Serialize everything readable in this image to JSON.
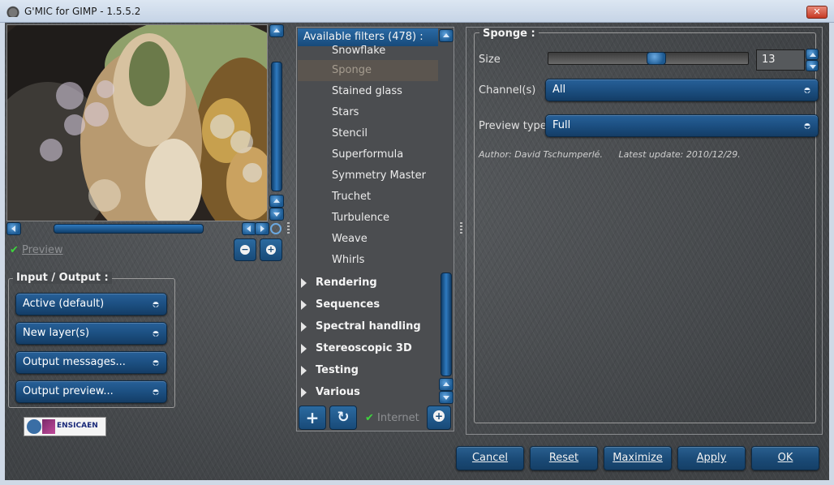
{
  "window": {
    "title": "G'MIC for GIMP - 1.5.5.2",
    "close_label": "✕"
  },
  "preview": {
    "checkbox_label": "Preview",
    "checked": true,
    "zoom_out_label": "−",
    "zoom_in_label": "+"
  },
  "io": {
    "group_title": "Input / Output :",
    "input_select": "Active (default)",
    "output_select": "New layer(s)",
    "messages_select": "Output messages...",
    "preview_select": "Output preview..."
  },
  "logo": {
    "text": "ENSICAEN"
  },
  "filters": {
    "header": "Available filters (478) :",
    "items": [
      {
        "label": "Snowflake"
      },
      {
        "label": "Sponge",
        "selected": true
      },
      {
        "label": "Stained glass"
      },
      {
        "label": "Stars"
      },
      {
        "label": "Stencil"
      },
      {
        "label": "Superformula"
      },
      {
        "label": "Symmetry Master"
      },
      {
        "label": "Truchet"
      },
      {
        "label": "Turbulence"
      },
      {
        "label": "Weave"
      },
      {
        "label": "Whirls"
      }
    ],
    "categories": [
      {
        "label": "Rendering"
      },
      {
        "label": "Sequences"
      },
      {
        "label": "Spectral handling"
      },
      {
        "label": "Stereoscopic 3D"
      },
      {
        "label": "Testing"
      },
      {
        "label": "Various"
      }
    ],
    "add_label": "+",
    "refresh_label": "↻",
    "internet_label": "Internet",
    "internet_checked": true
  },
  "params": {
    "title": "Sponge :",
    "size_label": "Size",
    "size_value": "13",
    "size_level": 0.55,
    "channels_label": "Channel(s)",
    "channels_value": "All",
    "preview_type_label": "Preview type",
    "preview_type_value": "Full",
    "author_line": "Author: David Tschumperlé.",
    "update_line": "Latest update: 2010/12/29."
  },
  "buttons": {
    "cancel": "Cancel",
    "reset": "Reset",
    "maximize": "Maximize",
    "apply": "Apply",
    "ok": "OK"
  }
}
